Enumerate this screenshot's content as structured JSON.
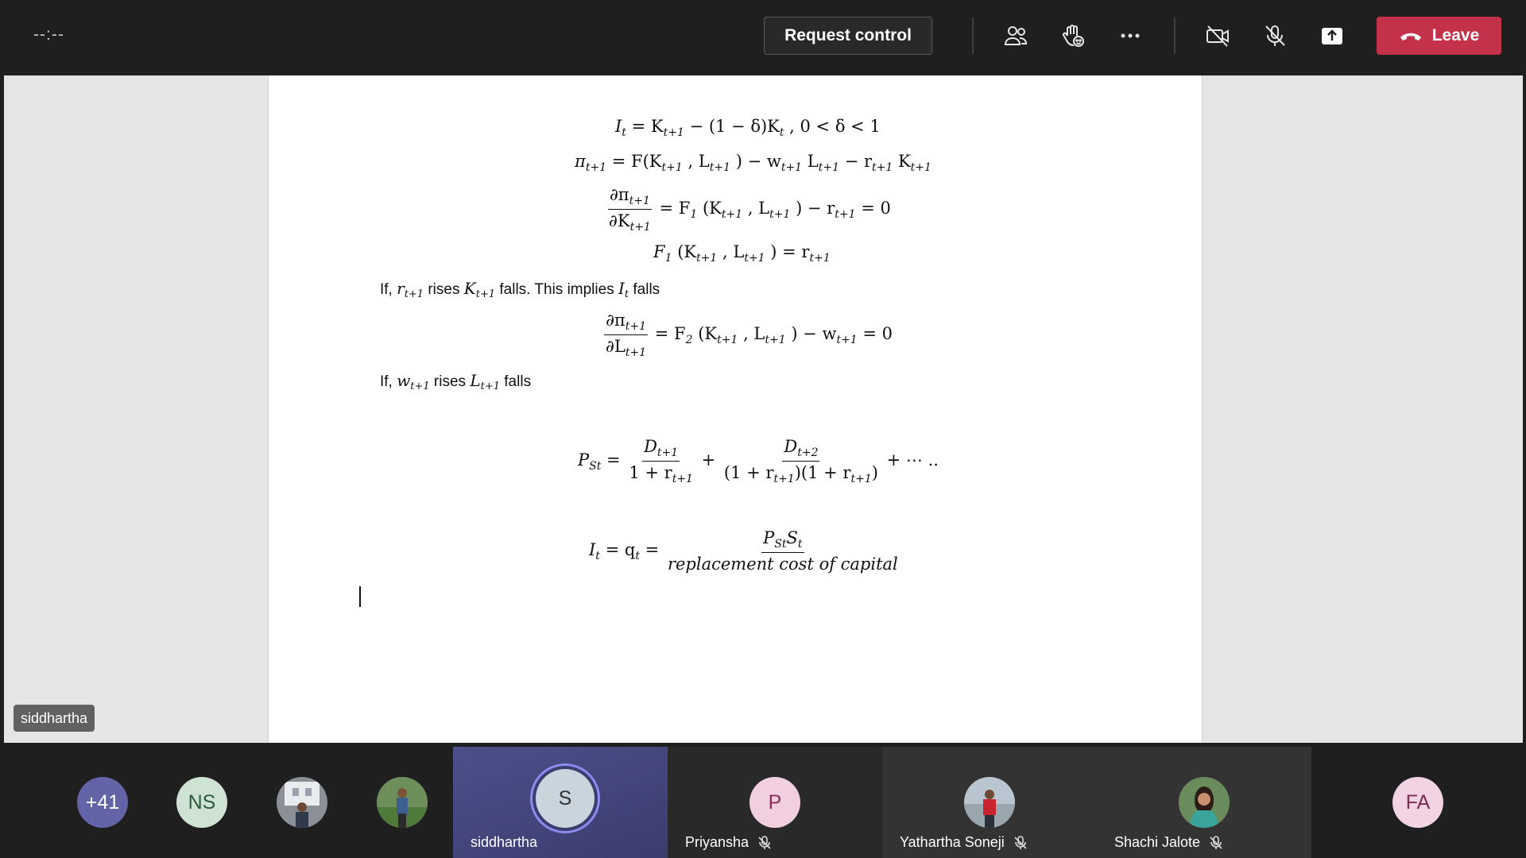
{
  "top_bar": {
    "timer": "--:--",
    "request_control_label": "Request control",
    "leave_label": "Leave",
    "accent_leave": "#c4314b",
    "icons": [
      "people-icon",
      "raise-hand-icon",
      "more-options-icon",
      "camera-off-icon",
      "mic-off-icon",
      "share-tray-icon"
    ]
  },
  "document": {
    "eq1": {
      "lhs": "I",
      "lhs_sub": "t",
      "t1": "= K",
      "t1_sub": "t+1",
      "t2": " − (1 − δ)K",
      "t2_sub": "t",
      "t3": ", 0 < δ < 1"
    },
    "eq2": {
      "a": "π",
      "a_sub": "t+1",
      "b": " = F(K",
      "b_sub": "t+1",
      "c": ", L",
      "c_sub": "t+1",
      "d": ") − w",
      "d_sub": "t+1",
      "e": "L",
      "e_sub": "t+1",
      "f": " − r",
      "f_sub": "t+1",
      "g": "K",
      "g_sub": "t+1"
    },
    "eq3": {
      "num": "∂π",
      "num_sub": "t+1",
      "den": "∂K",
      "den_sub": "t+1",
      "r1": "= F",
      "r1_sub": "1",
      "r2": "(K",
      "r2_sub": "t+1",
      "r3": ", L",
      "r3_sub": "t+1",
      "r4": ") − r",
      "r4_sub": "t+1",
      "r5": " = 0"
    },
    "eq4": {
      "a": "F",
      "a_sub": "1",
      "b": "(K",
      "b_sub": "t+1",
      "c": ", L",
      "c_sub": "t+1",
      "d": ") = r",
      "d_sub": "t+1"
    },
    "line1": {
      "p1": "If, ",
      "m1": "r",
      "m1_sub": "t+1",
      "p2": " rises ",
      "m2": "K",
      "m2_sub": "t+1",
      "p3": " falls. This implies ",
      "m3": "I",
      "m3_sub": "t",
      "p4": " falls"
    },
    "eq5": {
      "num": "∂π",
      "num_sub": "t+1",
      "den": "∂L",
      "den_sub": "t+1",
      "r1": "= F",
      "r1_sub": "2",
      "r2": "(K",
      "r2_sub": "t+1",
      "r3": ", L",
      "r3_sub": "t+1",
      "r4": ") − w",
      "r4_sub": "t+1",
      "r5": " = 0"
    },
    "line2": {
      "p1": "If, ",
      "m1": "w",
      "m1_sub": "t+1",
      "p2": " rises ",
      "m2": "L",
      "m2_sub": "t+1",
      "p3": " falls"
    },
    "eq6": {
      "lhs": "P",
      "lhs_sub": "St",
      "eq": " = ",
      "n1": "D",
      "n1_sub": "t+1",
      "d1": "1 + r",
      "d1_sub": "t+1",
      "plus": " + ",
      "n2": "D",
      "n2_sub": "t+2",
      "d2a": "(1 + r",
      "d2a_sub": "t+1",
      "d2b": ")(1 + r",
      "d2b_sub": "t+1",
      "d2c": ")",
      "tail": " + ⋯ .."
    },
    "eq7": {
      "lhs": "I",
      "lhs_sub": "t",
      "mid": " = q",
      "mid_sub": "t",
      "eq": " = ",
      "num_a": "P",
      "num_a_sub": "St",
      "num_b": "S",
      "num_b_sub": "t",
      "den": "replacement cost of capital"
    }
  },
  "presenter_label": "siddhartha",
  "gallery": {
    "overflow_count": "+41",
    "ns_initials": "NS",
    "presenter_initial": "S",
    "presenter_name": "siddhartha",
    "priyansha_initial": "P",
    "priyansha_name": "Priyansha",
    "yathartha_name": "Yathartha Soneji",
    "shachi_name": "Shachi Jalote",
    "fa_initials": "FA"
  }
}
